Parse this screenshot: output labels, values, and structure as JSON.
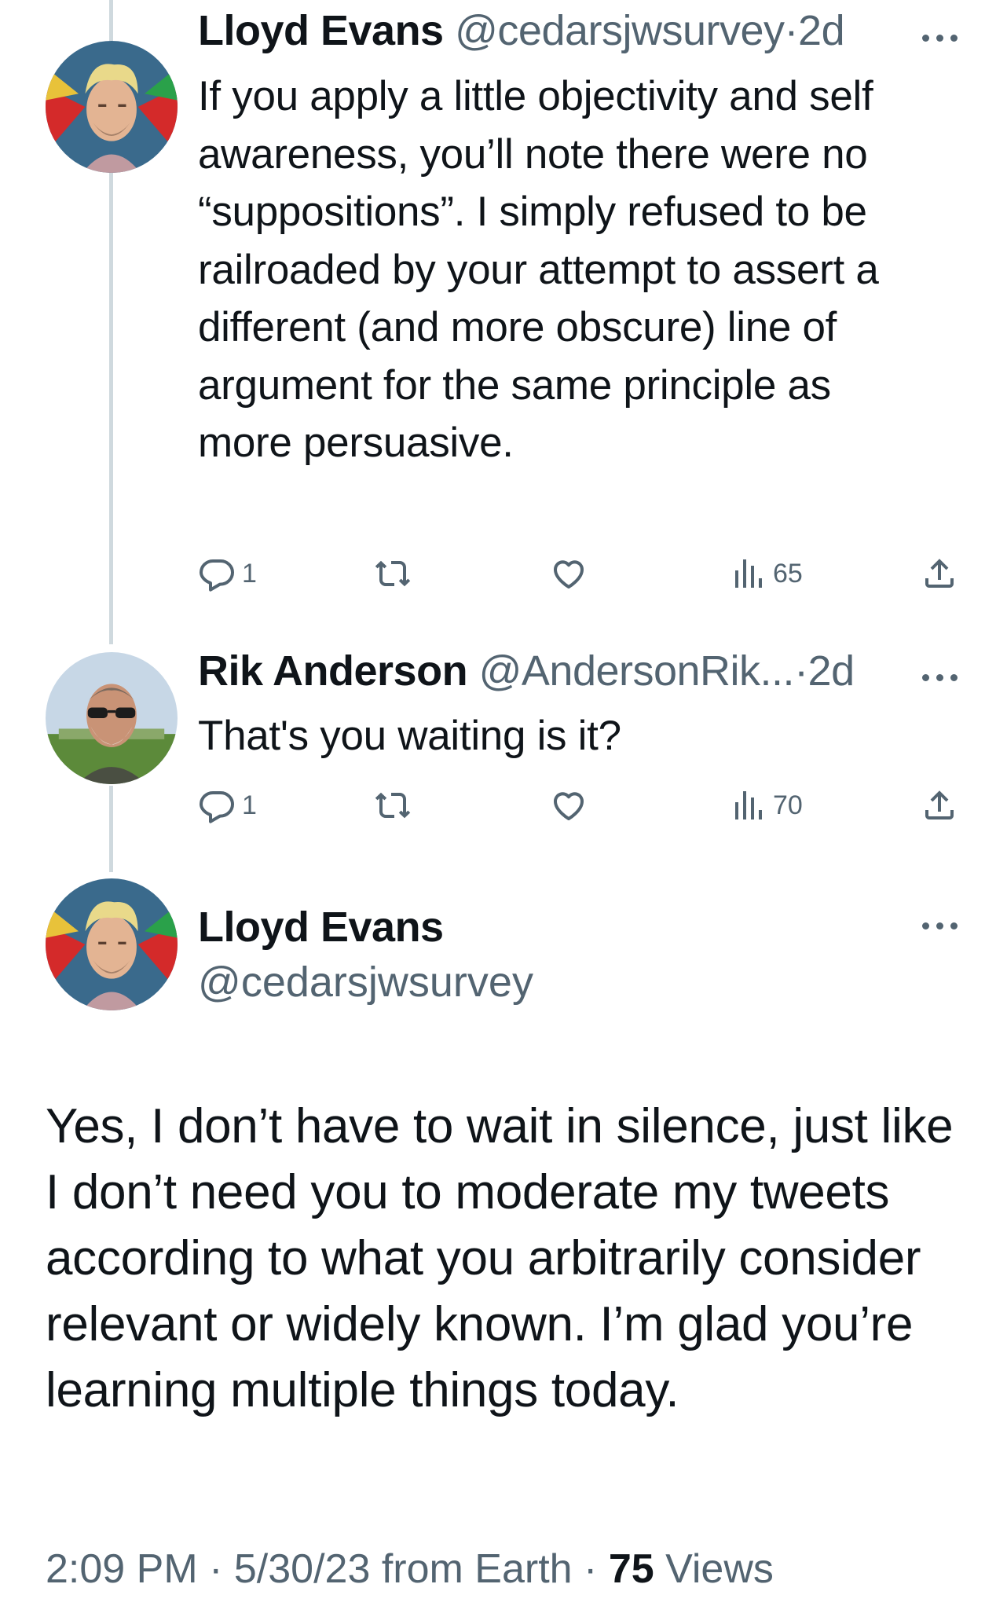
{
  "tweets": [
    {
      "name": "Lloyd Evans",
      "handle": "@cedarsjwsurvey",
      "separator": "·",
      "time": "2d",
      "text": "If you apply a little objectivity and self awareness, you’ll note there were no “suppositions”. I simply refused to be railroaded by your attempt to assert a different (and more obscure) line of argument for the same principle as more persuasive.",
      "replies": "1",
      "retweets": "",
      "likes": "",
      "views": "65"
    },
    {
      "name": "Rik Anderson",
      "handle": "@AndersonRik...",
      "separator": "·",
      "time": "2d",
      "text": "That's you waiting is it?",
      "replies": "1",
      "retweets": "",
      "likes": "",
      "views": "70"
    }
  ],
  "focus": {
    "name": "Lloyd Evans",
    "handle": "@cedarsjwsurvey",
    "text": "Yes, I don’t have to wait in silence, just like I don’t need you to moderate my tweets according to what you arbitrarily consider relevant or widely known. I’m glad you’re learning multiple things today.",
    "time": "2:09 PM",
    "date": "5/30/23",
    "source": "from Earth",
    "separator": "·",
    "views_count": "75",
    "views_label": "Views"
  },
  "icons": {
    "reply": "reply-icon",
    "retweet": "retweet-icon",
    "like": "heart-icon",
    "views": "views-icon",
    "share": "share-icon",
    "more": "more-icon"
  },
  "colors": {
    "text": "#0f1419",
    "secondary": "#536471",
    "thread_line": "#cfd9de"
  }
}
